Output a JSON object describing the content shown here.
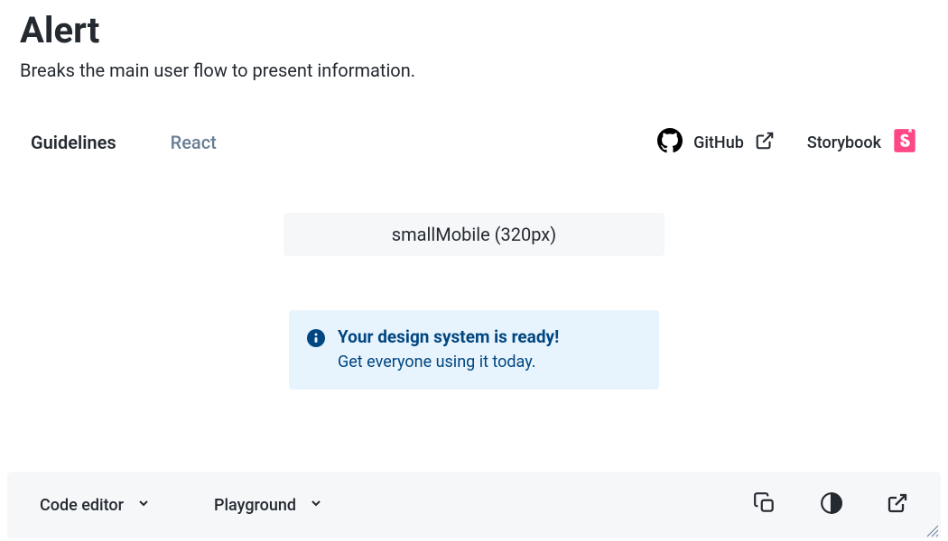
{
  "header": {
    "title": "Alert",
    "description": "Breaks the main user flow to present information."
  },
  "tabs": {
    "guidelines": "Guidelines",
    "react": "React"
  },
  "links": {
    "github": "GitHub",
    "storybook": "Storybook"
  },
  "preview": {
    "viewport": "smallMobile (320px)"
  },
  "alert": {
    "title": "Your design system is ready!",
    "text": "Get everyone using it today."
  },
  "bottomBar": {
    "codeEditor": "Code editor",
    "playground": "Playground"
  }
}
